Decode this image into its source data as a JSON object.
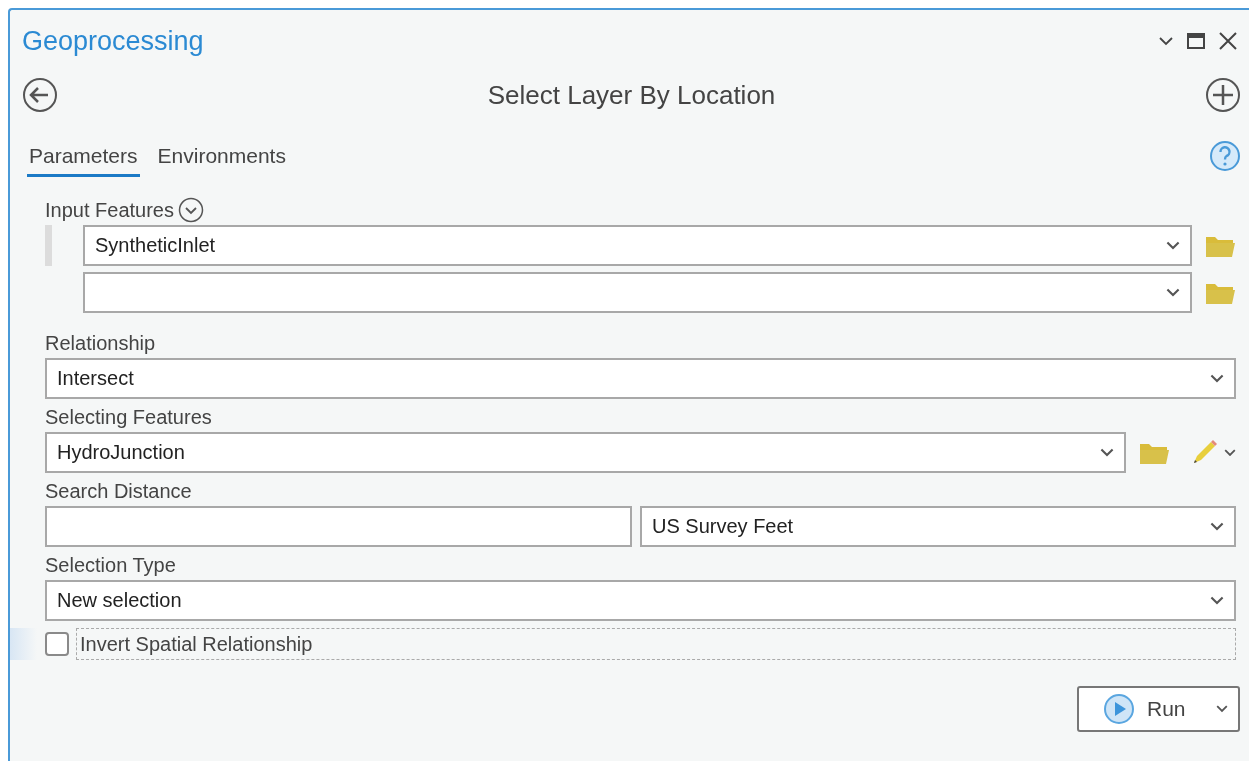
{
  "window": {
    "title": "Geoprocessing"
  },
  "tool": {
    "title": "Select Layer By Location"
  },
  "tabs": [
    {
      "label": "Parameters",
      "selected": true
    },
    {
      "label": "Environments",
      "selected": false
    }
  ],
  "parameters": [
    {
      "kind": "multi",
      "label": "Input Features",
      "rows": [
        {
          "value": "SyntheticInlet",
          "selected": true
        },
        {
          "selected": false
        }
      ]
    },
    {
      "kind": "dropdown",
      "label": "Relationship",
      "value": "Intersect"
    },
    {
      "kind": "layer",
      "label": "Selecting Features",
      "value": "HydroJunction"
    },
    {
      "kind": "distance",
      "label": "Search Distance",
      "unit": "US Survey Feet"
    },
    {
      "kind": "dropdown",
      "label": "Selection Type",
      "value": "New selection"
    },
    {
      "kind": "checkbox",
      "label": "Invert Spatial Relationship",
      "checked": false
    }
  ],
  "run_button": {
    "label": "Run"
  }
}
